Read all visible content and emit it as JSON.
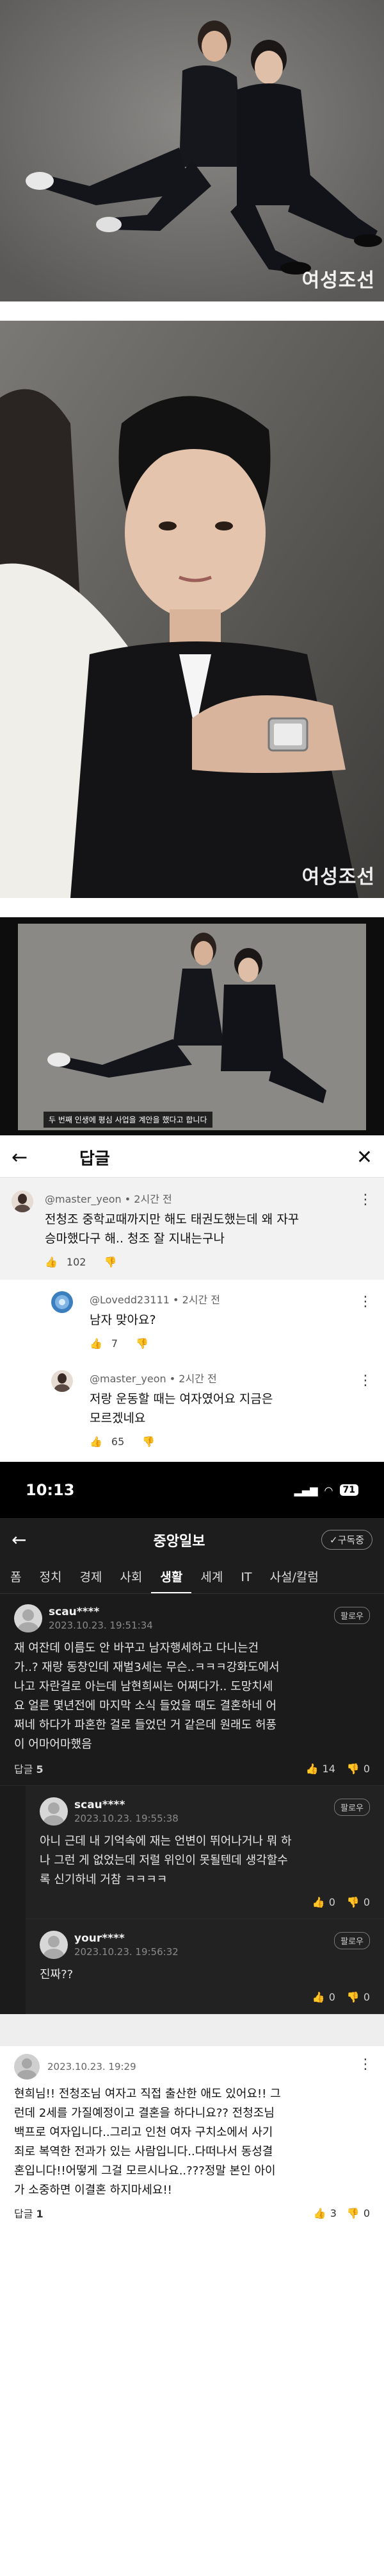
{
  "watermark": "여성조선",
  "photo3_caption": "두 번째 인생에 평심 사업을 계안을 했다고 합니다",
  "comments_sheet": {
    "title": "답글",
    "comments": [
      {
        "author": "@master_yeon",
        "time": "2시간 전",
        "text_line1": "전청조 중학교때까지만 해도 태권도했는데 왜 자꾸",
        "text_line2": "승마했다구 해.. 청조 잘 지내는구나",
        "likes": "102"
      },
      {
        "author": "@Lovedd23111",
        "time": "2시간 전",
        "text": "남자 맞아요?",
        "likes": "7"
      },
      {
        "author": "@master_yeon",
        "time": "2시간 전",
        "text_line1": "저랑 운동할 때는 여자였어요 지금은",
        "text_line2": "모르겠네요",
        "likes": "65"
      }
    ]
  },
  "status_bar": {
    "time": "10:13",
    "battery": "71"
  },
  "app_bar": {
    "title": "중앙일보",
    "subscribe": "✓구독중"
  },
  "tabs": [
    "폼",
    "정치",
    "경제",
    "사회",
    "생활",
    "세계",
    "IT",
    "사설/칼럼"
  ],
  "active_tab": "생활",
  "dark_comments": [
    {
      "author": "scau****",
      "date": "2023.10.23. 19:51:34",
      "follow": "팔로우",
      "lines": [
        "재 여잔데 이름도 안 바꾸고 남자행세하고 다니는건",
        "가..? 재랑 동창인데 재벌3세는 무슨..ㅋㅋㅋ강화도에서",
        "나고 자란걸로 아는데 남현희씨는 어쩌다가.. 도망치세",
        "요 얼른 몇년전에 마지막 소식 들었을 때도 결혼하네 어",
        "쩌네 하다가 파혼한 걸로 들었던 거 같은데 원래도 허풍",
        "이 어마어마했음"
      ],
      "reply_label": "답글",
      "reply_count": "5",
      "up": "14",
      "down": "0"
    },
    {
      "author": "scau****",
      "date": "2023.10.23. 19:55:38",
      "follow": "팔로우",
      "lines": [
        "아니 근데 내 기억속에 재는 언변이 뛰어나거나 뭐 하",
        "나 그런 게 없었는데 저럴 위인이 못될텐데 생각할수",
        "록 신기하네 거참 ㅋㅋㅋㅋ"
      ],
      "up": "0",
      "down": "0"
    },
    {
      "author": "your****",
      "date": "2023.10.23. 19:56:32",
      "follow": "팔로우",
      "lines": [
        "진짜??"
      ],
      "up": "0",
      "down": "0"
    }
  ],
  "light_comment": {
    "date": "2023.10.23. 19:29",
    "lines": [
      "현희님!! 전청조님 여자고 직접 출산한 애도 있어요!! 그",
      "런데 2세를 가질예정이고 결혼을 하다니요?? 전청조님",
      "백프로 여자입니다..그리고 인천 여자 구치소에서 사기",
      "죄로 복역한 전과가 있는 사람입니다..다떠나서 동성결",
      "혼입니다!!어떻게 그걸 모르시나요..???정말 본인 아이",
      "가 소중하면 이결혼 하지마세요!!"
    ],
    "reply_label": "답글",
    "reply_count": "1",
    "up": "3",
    "down": "0"
  }
}
